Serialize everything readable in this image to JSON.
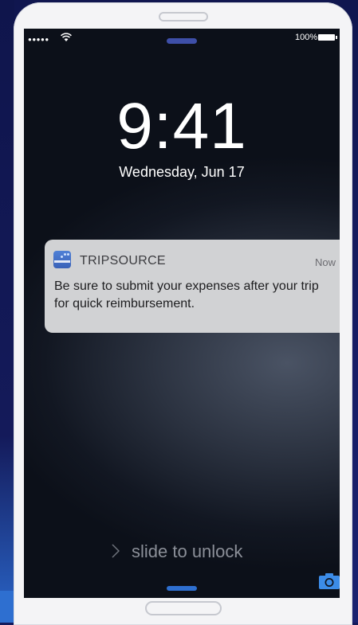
{
  "status_bar": {
    "signal": "●●●●●",
    "battery_percent": "100%"
  },
  "lock_screen": {
    "time": "9:41",
    "date": "Wednesday, Jun 17",
    "slide_to_unlock": "slide to unlock"
  },
  "notification": {
    "app_name": "TRIPSOURCE",
    "timestamp": "Now",
    "message": "Be sure to submit your expenses after your trip for quick reimbursement.",
    "app_icon_color": "#4a78d0"
  },
  "icons": {
    "wifi": "wifi-icon",
    "battery": "battery-icon",
    "chevron": "chevron-right-icon",
    "camera": "camera-icon",
    "app": "tripsource-app-icon"
  },
  "colors": {
    "page_background": "#141b5c",
    "phone_frame": "#f4f4f6",
    "accent_blue": "#2e6fd0",
    "notification_background": "#d1d2d4"
  }
}
